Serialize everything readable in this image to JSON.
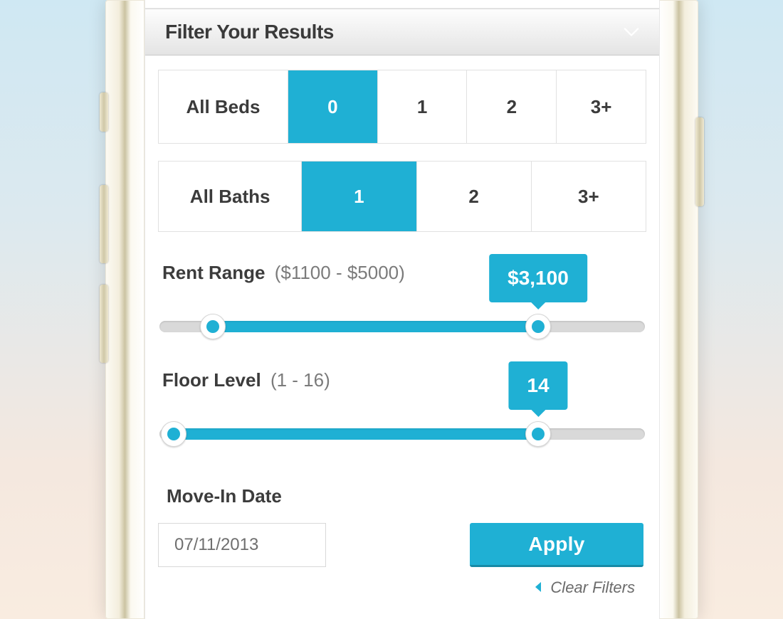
{
  "header": {
    "title": "Filter Your Results"
  },
  "beds": {
    "label": "All Beds",
    "options": [
      "0",
      "1",
      "2",
      "3+"
    ],
    "selected_index": 0
  },
  "baths": {
    "label": "All Baths",
    "options": [
      "1",
      "2",
      "3+"
    ],
    "selected_index": 0
  },
  "rent": {
    "label": "Rent Range",
    "hint": "($1100 - $5000)",
    "min": 1100,
    "max": 5000,
    "low_value": 1100,
    "high_value": 3100,
    "tooltip": "$3,100",
    "low_pct": 11,
    "high_pct": 78
  },
  "floor": {
    "label": "Floor Level",
    "hint": "(1 - 16)",
    "min": 1,
    "max": 16,
    "low_value": 1,
    "high_value": 14,
    "tooltip": "14",
    "low_pct": 3,
    "high_pct": 78
  },
  "movein": {
    "label": "Move-In Date",
    "value": "07/11/2013"
  },
  "actions": {
    "apply": "Apply",
    "clear": "Clear Filters"
  },
  "colors": {
    "accent": "#1fb0d4"
  }
}
